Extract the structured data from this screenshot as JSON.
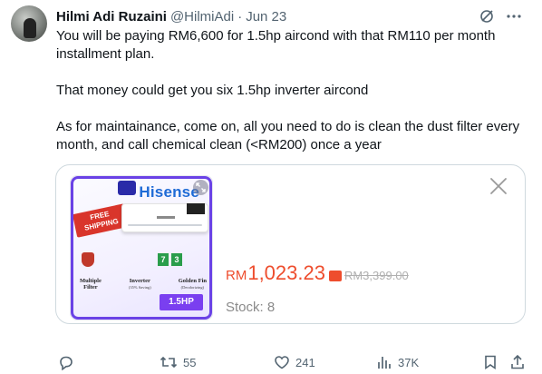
{
  "author": {
    "name": "Hilmi Adi Ruzaini",
    "handle": "@HilmiAdi",
    "separator": "·",
    "date": "Jun 23",
    "avatar_icon": "user-avatar"
  },
  "header_icons": [
    "grok-icon",
    "more-options-icon"
  ],
  "tweet": {
    "lines": [
      "You will be paying RM6,600 for 1.5hp aircond with that RM110 per month installment plan.",
      "",
      "That money could get you six 1.5hp inverter aircond",
      "",
      "As for maintainance, come on, all you need to do is clean the dust filter every month, and call chemical clean (<RM200) once a year"
    ]
  },
  "card": {
    "product_image": {
      "brand": "Hisense",
      "ribbon": "FREE SHIPPING",
      "warranty_badges": [
        "7",
        "3"
      ],
      "features": [
        {
          "title": "Multiple",
          "title2": "Filter",
          "sub": ""
        },
        {
          "title": "Inverter",
          "title2": "",
          "sub": "(35% Saving)"
        },
        {
          "title": "Golden Fin",
          "title2": "",
          "sub": "(Deodorizing)"
        }
      ],
      "size": "1.5HP"
    },
    "price": {
      "currency": "RM",
      "amount": "1,023.23",
      "original": "RM3,399.00",
      "color": "#ee4d2d"
    },
    "stock": "Stock: 8",
    "close_icon": "close-icon"
  },
  "actions": {
    "reply": {
      "icon": "reply-icon",
      "count": ""
    },
    "retweet": {
      "icon": "retweet-icon",
      "count": "55"
    },
    "like": {
      "icon": "heart-icon",
      "count": "241"
    },
    "views": {
      "icon": "views-icon",
      "count": "37K"
    },
    "bookmark": {
      "icon": "bookmark-icon",
      "count": ""
    },
    "share": {
      "icon": "share-icon",
      "count": ""
    }
  }
}
